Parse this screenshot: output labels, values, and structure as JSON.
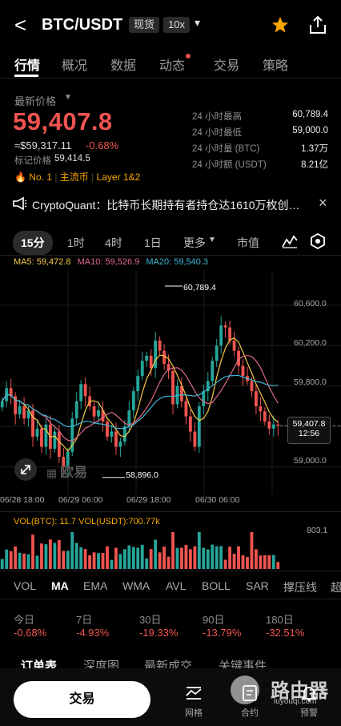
{
  "header": {
    "back": "<",
    "pair": "BTC/USDT",
    "tag_spot": "现货",
    "tag_leverage": "10x",
    "dropdown": "▾"
  },
  "tabs": [
    "行情",
    "概况",
    "数据",
    "动态",
    "交易",
    "策略"
  ],
  "price": {
    "label": "最新价格",
    "value": "59,407.8",
    "approx": "≈$59,317.11",
    "change": "-0.68%",
    "mark_label": "标记价格",
    "mark_value": "59,414.5",
    "rank": "No. 1",
    "badge1": "主流币",
    "badge2": "Layer 1&2"
  },
  "stats": [
    {
      "label": "24 小时最高",
      "value": "60,789.4"
    },
    {
      "label": "24 小时最低",
      "value": "59,000.0"
    },
    {
      "label": "24 小时量 (BTC)",
      "value": "1.37万"
    },
    {
      "label": "24 小时额 (USDT)",
      "value": "8.21亿"
    }
  ],
  "news": {
    "text": "CryptoQuant：比特币长期持有者持仓达1610万枚创…",
    "close": "×"
  },
  "intervals": [
    "15分",
    "1时",
    "4时",
    "1日"
  ],
  "more": "更多",
  "market_cap": "市值",
  "ma_legend": {
    "ma5": "MA5: 59,472.8",
    "ma10": "MA10: 59,526.9",
    "ma20": "MA20: 59,540.3"
  },
  "colors": {
    "ma5": "#f7c948",
    "ma10": "#e06a8a",
    "ma20": "#3fb6d6",
    "up": "#26a69a",
    "down": "#ef5450"
  },
  "chart_data": {
    "type": "candlestick",
    "y_ticks": [
      "60,600.0",
      "60,200.0",
      "59,800.0",
      "59,000.0"
    ],
    "x_ticks": [
      "06/28 18:00",
      "06/29 06:00",
      "06/29 18:00",
      "06/30 06:00"
    ],
    "high_label": "60,789.4",
    "low_label": "58,896.0",
    "current_price": "59,407.8",
    "countdown": "12:56",
    "ylim": [
      58800,
      60900
    ],
    "close": [
      59650,
      59780,
      59700,
      59520,
      59600,
      59480,
      59560,
      59300,
      59380,
      59200,
      59420,
      59180,
      59350,
      59100,
      59000,
      59150,
      59480,
      59650,
      59820,
      59700,
      59600,
      59500,
      59560,
      59450,
      59300,
      59350,
      59200,
      59250,
      59400,
      59560,
      59750,
      59900,
      60050,
      60100,
      59980,
      60250,
      60150,
      60020,
      59950,
      59620,
      59800,
      59650,
      59500,
      59350,
      59200,
      59600,
      59750,
      59850,
      60050,
      60200,
      60400,
      60380,
      60250,
      60150,
      60000,
      59900,
      59850,
      59750,
      59600,
      59550,
      59450,
      59380,
      59420,
      59407.8
    ]
  },
  "volume": {
    "label_btc": "VOL(BTC): 11.7",
    "label_usdt": "VOL(USDT):700.77k",
    "max": "803.1"
  },
  "indicators": [
    "VOL",
    "MA",
    "EMA",
    "WMA",
    "AVL",
    "BOLL",
    "SAR",
    "撑压线",
    "超"
  ],
  "changes": [
    {
      "label": "今日",
      "value": "-0.68%"
    },
    {
      "label": "7日",
      "value": "-4.93%"
    },
    {
      "label": "30日",
      "value": "-19.33%"
    },
    {
      "label": "90日",
      "value": "-13.79%"
    },
    {
      "label": "180日",
      "value": "-32.51%"
    }
  ],
  "book_tabs": [
    "订单表",
    "深度图",
    "最新成交",
    "关键事件"
  ],
  "bottom": {
    "trade": "交易",
    "nav1": "网格",
    "nav2": "合约",
    "nav3": "预警"
  },
  "watermark": {
    "cn": "路由器",
    "url": "luyouqi.com"
  },
  "exchange_logo": "欧易"
}
